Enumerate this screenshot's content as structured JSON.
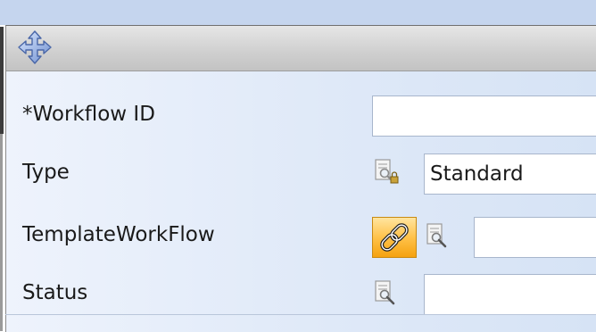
{
  "icons": {
    "move": "move-arrows-icon",
    "lookup": "magnifier-document-icon",
    "lookup_locked": "locked-magnifier-document-icon",
    "link": "chain-link-icon"
  },
  "colors": {
    "panel_bg": "#dfe9f8",
    "header_bg": "#cfcfcf",
    "link_button": "#ffc24a",
    "input_bg": "#ffffff"
  },
  "form": {
    "workflow_id": {
      "label": "*Workflow ID",
      "value": ""
    },
    "type": {
      "label": "Type",
      "value": "Standard"
    },
    "template_workflow": {
      "label": "TemplateWorkFlow",
      "value": ""
    },
    "status": {
      "label": "Status",
      "value": ""
    }
  }
}
